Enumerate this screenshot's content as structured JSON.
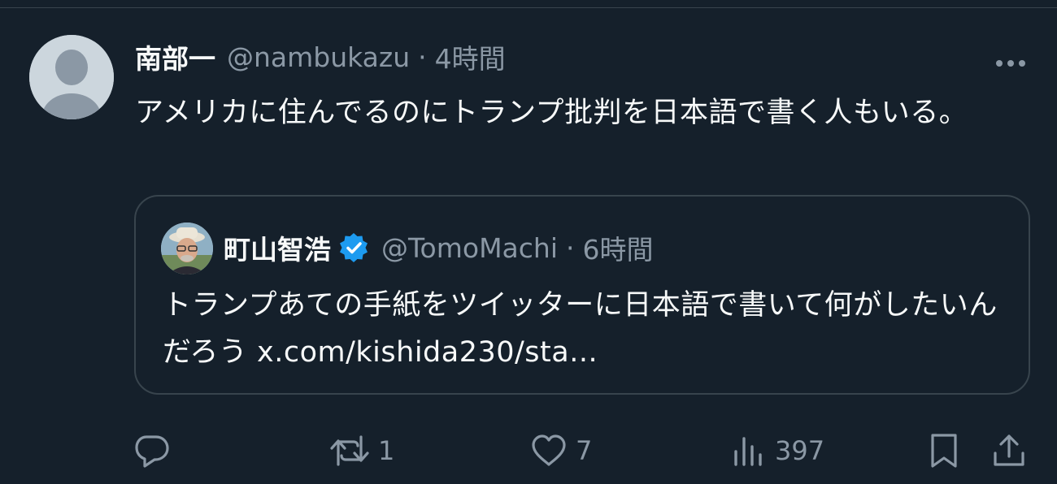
{
  "tweet": {
    "display_name": "南部一",
    "handle": "@nambukazu",
    "separator": "·",
    "time": "4時間",
    "text": "アメリカに住んでるのにトランプ批判を日本語で書く人もいる。"
  },
  "quote": {
    "display_name": "町山智浩",
    "verified": true,
    "handle": "@TomoMachi",
    "separator": "·",
    "time": "6時間",
    "text": "トランプあての手紙をツイッターに日本語で書いて何がしたいんだろう x.com/kishida230/sta..."
  },
  "actions": {
    "reply": {
      "icon": "reply-icon",
      "count": ""
    },
    "retweet": {
      "icon": "retweet-icon",
      "count": "1"
    },
    "like": {
      "icon": "heart-icon",
      "count": "7"
    },
    "views": {
      "icon": "views-icon",
      "count": "397"
    },
    "bookmark": {
      "icon": "bookmark-icon"
    },
    "share": {
      "icon": "share-icon"
    }
  },
  "colors": {
    "background": "#15202b",
    "text_primary": "#f7f9f9",
    "text_secondary": "#8b98a5",
    "border": "#38444d",
    "verified_blue": "#1d9bf0"
  }
}
